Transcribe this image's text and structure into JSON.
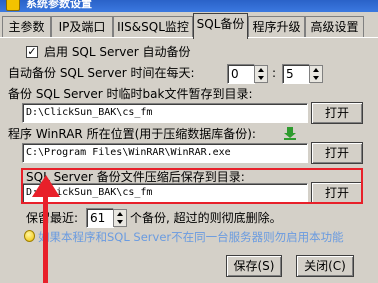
{
  "window": {
    "title": "系统参数设置"
  },
  "tabs": [
    {
      "label": "主参数"
    },
    {
      "label": "IP及端口"
    },
    {
      "label": "IIS&SQL监控"
    },
    {
      "label": "SQL备份"
    },
    {
      "label": "程序升级"
    },
    {
      "label": "高级设置"
    }
  ],
  "backup": {
    "enable_label": "启用 SQL Server 自动备份",
    "enabled": true,
    "time_label": "自动备份 SQL Server 时间在每天:",
    "hour": "0",
    "colon": ":",
    "minute": "5",
    "temp_dir_label": "备份 SQL Server 时临时bak文件暂存到目录:",
    "temp_dir_value": "D:\\ClickSun_BAK\\cs_fm",
    "winrar_label": "程序 WinRAR 所在位置(用于压缩数据库备份):",
    "winrar_value": "C:\\Program Files\\WinRAR\\WinRAR.exe",
    "compressed_dir_label": "SQL Server 备份文件压缩后保存到目录:",
    "compressed_dir_value": "D:\\ClickSun_BAK\\cs_fm",
    "keep_prefix": "保留最近:",
    "keep_count": "61",
    "keep_suffix": "个备份, 超过的则彻底删除。",
    "hint": "如果本程序和SQL Server不在同一台服务器则勿启用本功能",
    "open_label": "打开"
  },
  "footer": {
    "save_label": "保存(S)",
    "close_label": "关闭(C)"
  },
  "colors": {
    "annotation": "#e8202a",
    "hint_text": "#6a9be0",
    "titlebar": "#2a62c8"
  }
}
